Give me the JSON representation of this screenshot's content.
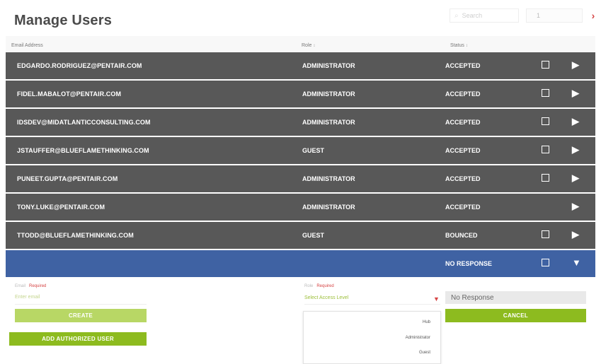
{
  "page": {
    "title": "Manage Users"
  },
  "top": {
    "search_placeholder": "Search",
    "page_value": "1",
    "next_arrow": "›"
  },
  "table": {
    "headers": {
      "email": "Email Address",
      "role": "Role",
      "status": "Status",
      "sort_glyph": "↕"
    },
    "rows": [
      {
        "email": "EDGARDO.RODRIGUEZ@PENTAIR.COM",
        "role": "ADMINISTRATOR",
        "status": "ACCEPTED"
      },
      {
        "email": "FIDEL.MABALOT@PENTAIR.COM",
        "role": "ADMINISTRATOR",
        "status": "ACCEPTED"
      },
      {
        "email": "IDSDEV@MIDATLANTICCONSULTING.COM",
        "role": "ADMINISTRATOR",
        "status": "ACCEPTED"
      },
      {
        "email": "JSTAUFFER@BLUEFLAMETHINKING.COM",
        "role": "GUEST",
        "status": "ACCEPTED"
      },
      {
        "email": "PUNEET.GUPTA@PENTAIR.COM",
        "role": "ADMINISTRATOR",
        "status": "ACCEPTED"
      },
      {
        "email": "TONY.LUKE@PENTAIR.COM",
        "role": "ADMINISTRATOR",
        "status": "ACCEPTED"
      },
      {
        "email": "TTODD@BLUEFLAMETHINKING.COM",
        "role": "GUEST",
        "status": "BOUNCED"
      },
      {
        "email": "",
        "role": "",
        "status": "NO RESPONSE"
      }
    ]
  },
  "form": {
    "email_label": "Email",
    "email_required": "Required",
    "email_placeholder": "Enter email",
    "role_label": "Role",
    "role_required": "Required",
    "role_placeholder": "Select Access Level",
    "status_value": "No Response",
    "create_label": "CREATE",
    "cancel_label": "CANCEL",
    "add_label": "ADD AUTHORIZED USER"
  },
  "dropdown": {
    "options": [
      "Hub",
      "Administrator",
      "Guest"
    ]
  },
  "icons": {
    "arrow_right": "▶",
    "arrow_down": "▼",
    "caret": "▼",
    "search": "⌕"
  },
  "colors": {
    "row_bg": "#585858",
    "selected_bg": "#3f62a3",
    "green": "#8dbb1f",
    "light_green": "#b8d765",
    "accent_red": "#d64545"
  }
}
